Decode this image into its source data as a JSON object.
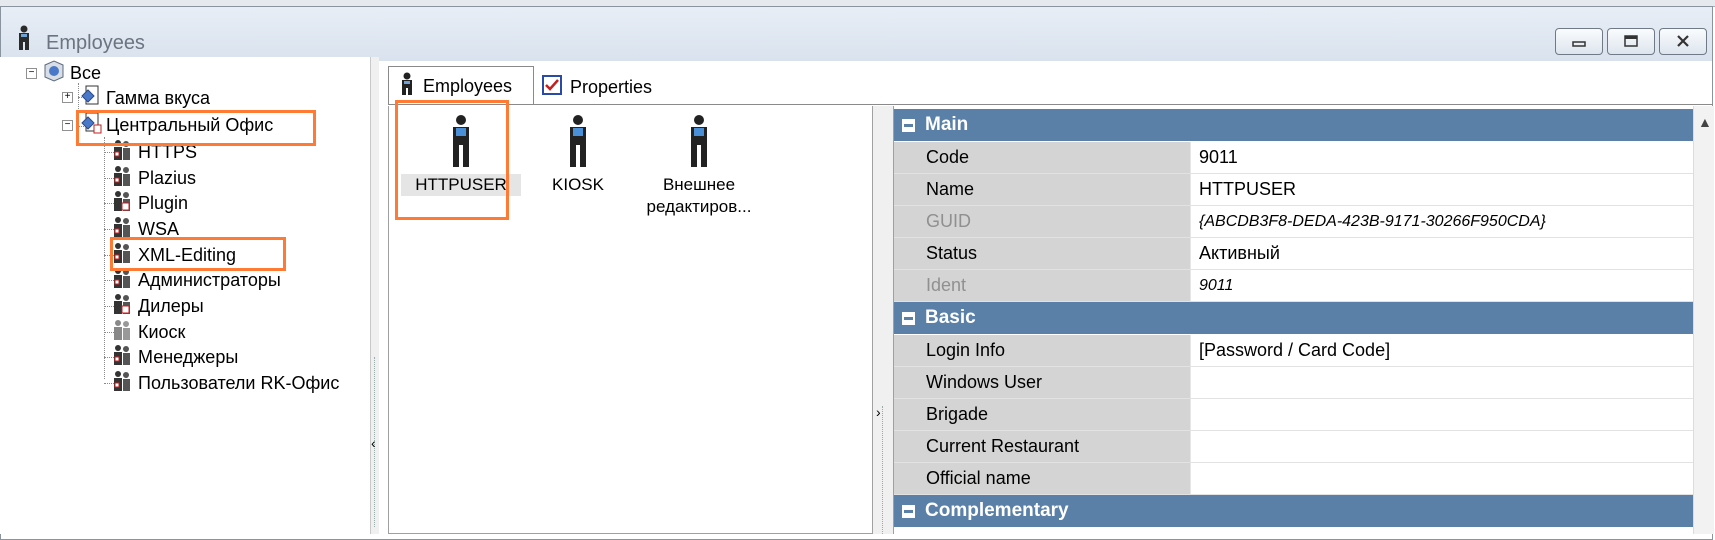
{
  "window": {
    "title": "Employees",
    "controls": [
      "minimize",
      "maximize",
      "close"
    ]
  },
  "tree": {
    "root": "Все",
    "groups": [
      {
        "label": "Гамма вкуса",
        "expanded": false
      },
      {
        "label": "Центральный Офис",
        "expanded": true
      }
    ],
    "children": [
      "HTTPS",
      "Plazius",
      "Plugin",
      "WSA",
      "XML-Editing",
      "Администраторы",
      "Дилеры",
      "Киоск",
      "Менеджеры",
      "Пользователи RK-Офис"
    ]
  },
  "tabs": [
    {
      "label": "Employees",
      "icon": "person-icon",
      "active": true
    },
    {
      "label": "Properties",
      "icon": "properties-icon",
      "active": false
    }
  ],
  "employees": [
    {
      "name": "HTTPUSER",
      "selected": true
    },
    {
      "name": "KIOSK",
      "selected": false
    },
    {
      "name": "Внешнее редактиров...",
      "selected": false
    }
  ],
  "properties": {
    "main_label": "Main",
    "basic_label": "Basic",
    "complementary_label": "Complementary",
    "main": [
      {
        "name": "Code",
        "value": "9011",
        "disabled": false,
        "italic": false
      },
      {
        "name": "Name",
        "value": "HTTPUSER",
        "disabled": false,
        "italic": false
      },
      {
        "name": "GUID",
        "value": "{ABCDB3F8-DEDA-423B-9171-30266F950CDA}",
        "disabled": true,
        "italic": true
      },
      {
        "name": "Status",
        "value": "Активный",
        "disabled": false,
        "italic": false
      },
      {
        "name": "Ident",
        "value": "9011",
        "disabled": true,
        "italic": true
      }
    ],
    "basic": [
      {
        "name": "Login Info",
        "value": "[Password / Card Code]"
      },
      {
        "name": "Windows User",
        "value": ""
      },
      {
        "name": "Brigade",
        "value": ""
      },
      {
        "name": "Current Restaurant",
        "value": ""
      },
      {
        "name": "Official name",
        "value": ""
      }
    ]
  },
  "colors": {
    "category_header": "#5a80a8",
    "highlight": "#ff7a33",
    "property_name_bg": "#d4d4d4"
  }
}
